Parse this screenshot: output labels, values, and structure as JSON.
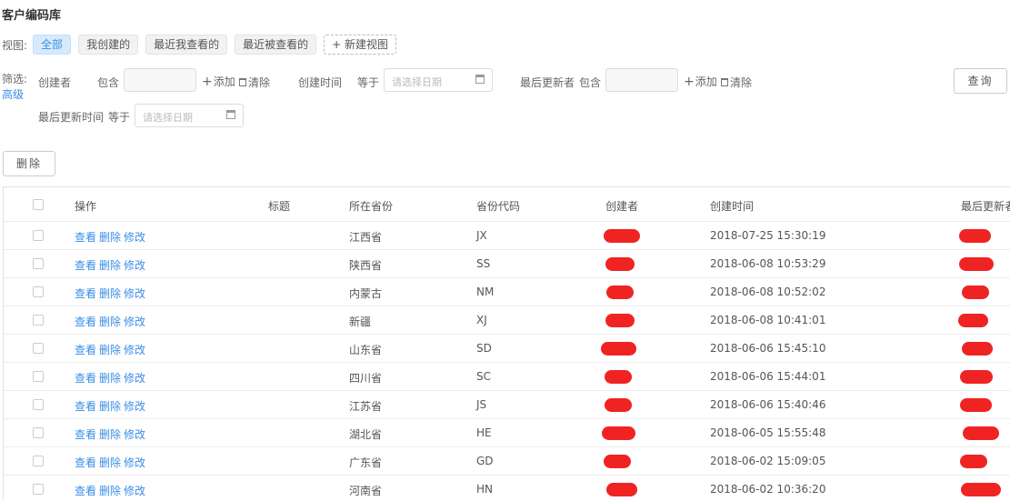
{
  "page": {
    "title": "客户编码库"
  },
  "view": {
    "label": "视图:",
    "options": [
      {
        "label": "全部",
        "active": true
      },
      {
        "label": "我创建的",
        "active": false
      },
      {
        "label": "最近我查看的",
        "active": false
      },
      {
        "label": "最近被查看的",
        "active": false
      }
    ],
    "new_view": "+ 新建视图"
  },
  "filter": {
    "label": "筛选:",
    "advanced": "高级",
    "creator_label": "创建者",
    "creator_op": "包含",
    "add_label": "添加",
    "clear_label": "清除",
    "create_time_label": "创建时间",
    "create_time_op": "等于",
    "date_placeholder": "请选择日期",
    "last_updater_label": "最后更新者",
    "last_updater_op": "包含",
    "last_update_time_label": "最后更新时间",
    "last_update_time_op": "等于",
    "query_button": "查询"
  },
  "toolbar": {
    "delete_button": "删除"
  },
  "table": {
    "headers": [
      "操作",
      "标题",
      "所在省份",
      "省份代码",
      "创建者",
      "创建时间",
      "最后更新者"
    ],
    "action_labels": [
      "查看",
      "删除",
      "修改"
    ],
    "rows": [
      {
        "province": "江西省",
        "code": "JX",
        "created": "2018-07-25 15:30:19"
      },
      {
        "province": "陕西省",
        "code": "SS",
        "created": "2018-06-08 10:53:29"
      },
      {
        "province": "内蒙古",
        "code": "NM",
        "created": "2018-06-08 10:52:02"
      },
      {
        "province": "新疆",
        "code": "XJ",
        "created": "2018-06-08 10:41:01"
      },
      {
        "province": "山东省",
        "code": "SD",
        "created": "2018-06-06 15:45:10"
      },
      {
        "province": "四川省",
        "code": "SC",
        "created": "2018-06-06 15:44:01"
      },
      {
        "province": "江苏省",
        "code": "JS",
        "created": "2018-06-06 15:40:46"
      },
      {
        "province": "湖北省",
        "code": "HE",
        "created": "2018-06-05 15:55:48"
      },
      {
        "province": "广东省",
        "code": "GD",
        "created": "2018-06-02 15:09:05"
      },
      {
        "province": "河南省",
        "code": "HN",
        "created": "2018-06-02 10:36:20"
      }
    ]
  },
  "colors": {
    "accent": "#3a8ee6",
    "redaction": "#f02323"
  }
}
